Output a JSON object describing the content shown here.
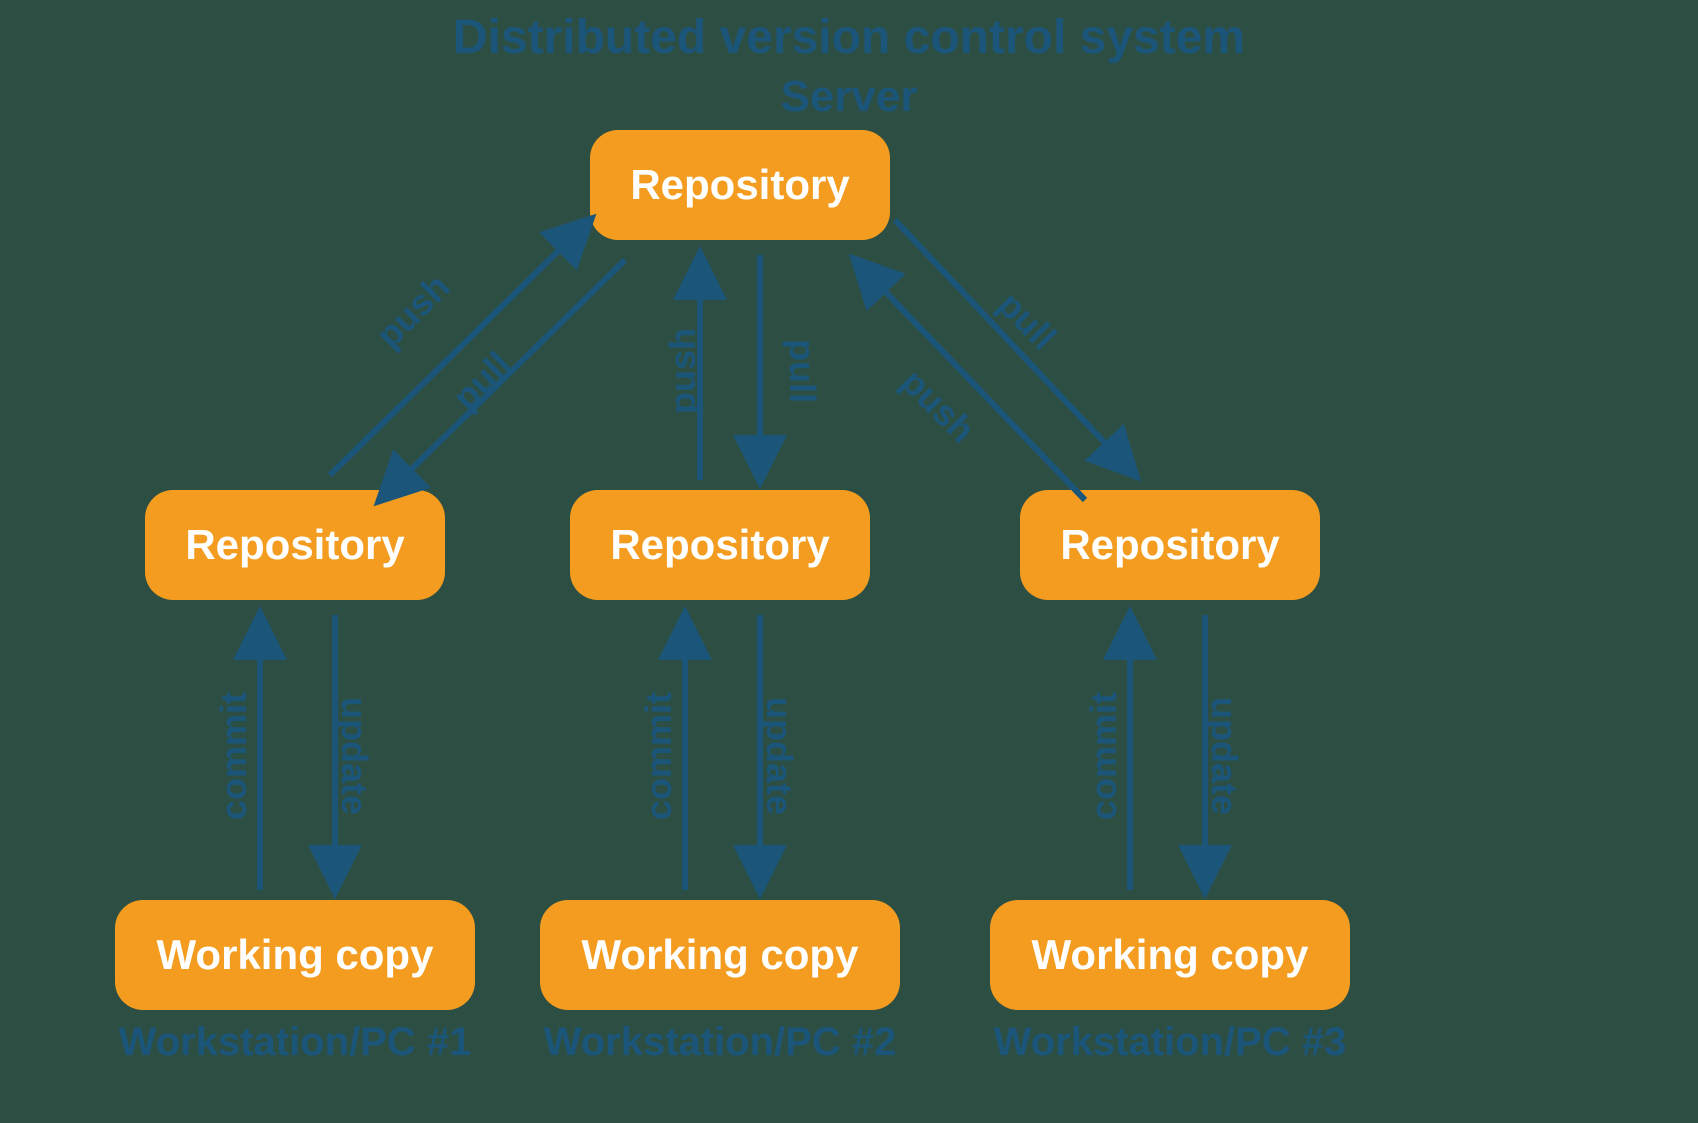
{
  "title": "Distributed version control system",
  "server_label": "Server",
  "node_labels": {
    "server_repo": "Repository",
    "repo1": "Repository",
    "repo2": "Repository",
    "repo3": "Repository",
    "wc1": "Working copy",
    "wc2": "Working copy",
    "wc3": "Working copy"
  },
  "captions": {
    "ws1": "Workstation/PC #1",
    "ws2": "Workstation/PC #2",
    "ws3": "Workstation/PC #3"
  },
  "edge_labels": {
    "push1": "push",
    "pull1": "pull",
    "push2": "push",
    "pull2": "pull",
    "push3": "push",
    "pull3": "pull",
    "commit1": "commit",
    "update1": "update",
    "commit2": "commit",
    "update2": "update",
    "commit3": "commit",
    "update3": "update"
  },
  "colors": {
    "box_fill": "#f39c1f",
    "box_text": "#ffffff",
    "line": "#1b567a",
    "background": "#2d4e43"
  }
}
